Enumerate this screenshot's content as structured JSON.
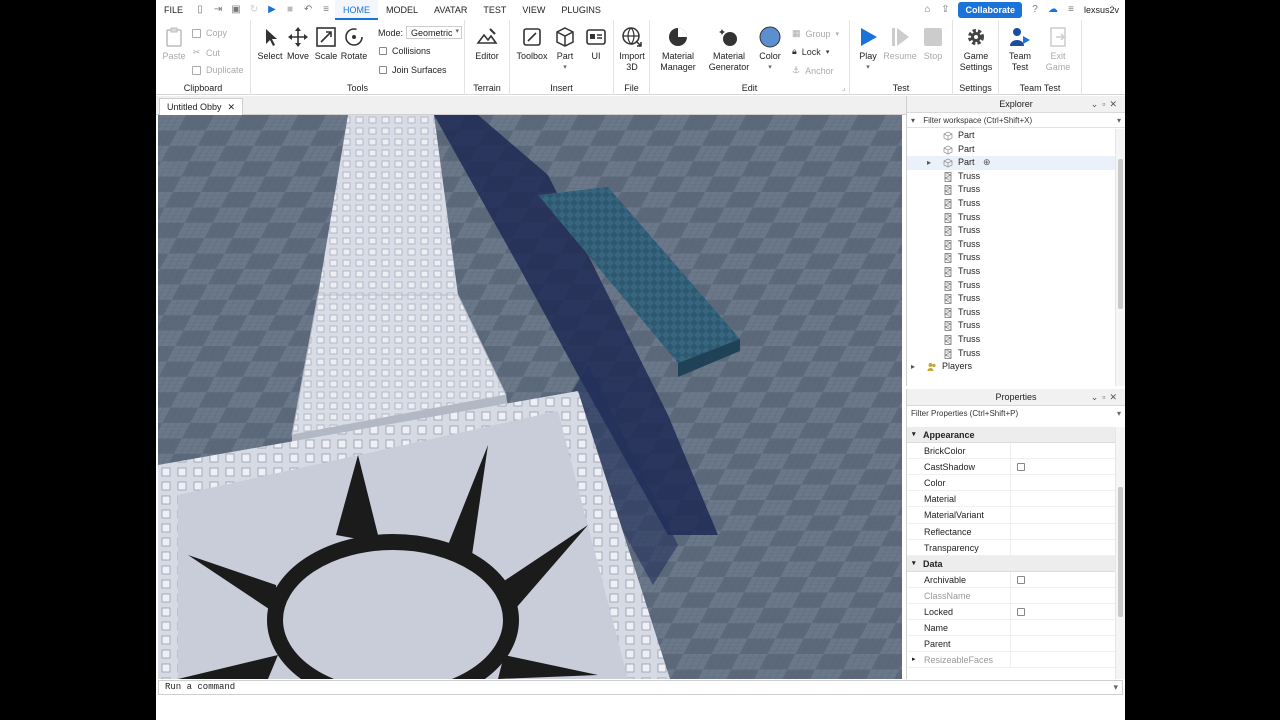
{
  "menu": {
    "file": "FILE",
    "tabs": [
      "HOME",
      "MODEL",
      "AVATAR",
      "TEST",
      "VIEW",
      "PLUGINS"
    ],
    "active_tab": "HOME",
    "collaborate": "Collaborate",
    "username": "lexsus2v"
  },
  "ribbon": {
    "clipboard": {
      "paste": "Paste",
      "copy": "Copy",
      "cut": "Cut",
      "duplicate": "Duplicate",
      "group_name": "Clipboard"
    },
    "tools": {
      "select": "Select",
      "move": "Move",
      "scale": "Scale",
      "rotate": "Rotate",
      "mode_label": "Mode:",
      "mode_value": "Geometric",
      "collisions": "Collisions",
      "join_surfaces": "Join Surfaces",
      "group_name": "Tools"
    },
    "terrain": {
      "editor": "Editor",
      "group_name": "Terrain"
    },
    "insert": {
      "toolbox": "Toolbox",
      "part": "Part",
      "ui": "UI",
      "group_name": "Insert"
    },
    "file": {
      "import_line1": "Import",
      "import_line2": "3D",
      "group_name": "File"
    },
    "edit": {
      "material_manager_1": "Material",
      "material_manager_2": "Manager",
      "material_generator_1": "Material",
      "material_generator_2": "Generator",
      "color": "Color",
      "group": "Group",
      "lock": "Lock",
      "anchor": "Anchor",
      "group_name": "Edit"
    },
    "test": {
      "play": "Play",
      "resume": "Resume",
      "stop": "Stop",
      "group_name": "Test"
    },
    "settings": {
      "game_settings_1": "Game",
      "game_settings_2": "Settings",
      "group_name": "Settings"
    },
    "team_test": {
      "team_test_1": "Team",
      "team_test_2": "Test",
      "exit_game_1": "Exit",
      "exit_game_2": "Game",
      "group_name": "Team Test"
    }
  },
  "document_tab": {
    "title": "Untitled Obby"
  },
  "explorer": {
    "title": "Explorer",
    "filter": "Filter workspace (Ctrl+Shift+X)",
    "items": [
      {
        "label": "Part",
        "type": "part"
      },
      {
        "label": "Part",
        "type": "part"
      },
      {
        "label": "Part",
        "type": "part",
        "selected": true
      },
      {
        "label": "Truss",
        "type": "truss"
      },
      {
        "label": "Truss",
        "type": "truss"
      },
      {
        "label": "Truss",
        "type": "truss"
      },
      {
        "label": "Truss",
        "type": "truss"
      },
      {
        "label": "Truss",
        "type": "truss"
      },
      {
        "label": "Truss",
        "type": "truss"
      },
      {
        "label": "Truss",
        "type": "truss"
      },
      {
        "label": "Truss",
        "type": "truss"
      },
      {
        "label": "Truss",
        "type": "truss"
      },
      {
        "label": "Truss",
        "type": "truss"
      },
      {
        "label": "Truss",
        "type": "truss"
      },
      {
        "label": "Truss",
        "type": "truss"
      },
      {
        "label": "Truss",
        "type": "truss"
      },
      {
        "label": "Truss",
        "type": "truss"
      },
      {
        "label": "Players",
        "type": "players"
      }
    ]
  },
  "properties": {
    "title": "Properties",
    "filter": "Filter Properties (Ctrl+Shift+P)",
    "sections": [
      {
        "name": "Appearance",
        "props": [
          {
            "name": "BrickColor"
          },
          {
            "name": "CastShadow",
            "checkbox": true
          },
          {
            "name": "Color"
          },
          {
            "name": "Material"
          },
          {
            "name": "MaterialVariant"
          },
          {
            "name": "Reflectance"
          },
          {
            "name": "Transparency"
          }
        ]
      },
      {
        "name": "Data",
        "props": [
          {
            "name": "Archivable",
            "checkbox": true
          },
          {
            "name": "ClassName",
            "grey": true
          },
          {
            "name": "Locked",
            "checkbox": true
          },
          {
            "name": "Name"
          },
          {
            "name": "Parent"
          },
          {
            "name": "ResizeableFaces",
            "grey": true,
            "collapsed": true
          }
        ]
      }
    ]
  },
  "command_bar": {
    "placeholder": "Run a command"
  },
  "colors": {
    "accent": "#1a73d9",
    "viewport_floor": "#5f6c7e",
    "platform": "#c8ccd8",
    "mesh_block": "#2e5a73"
  }
}
